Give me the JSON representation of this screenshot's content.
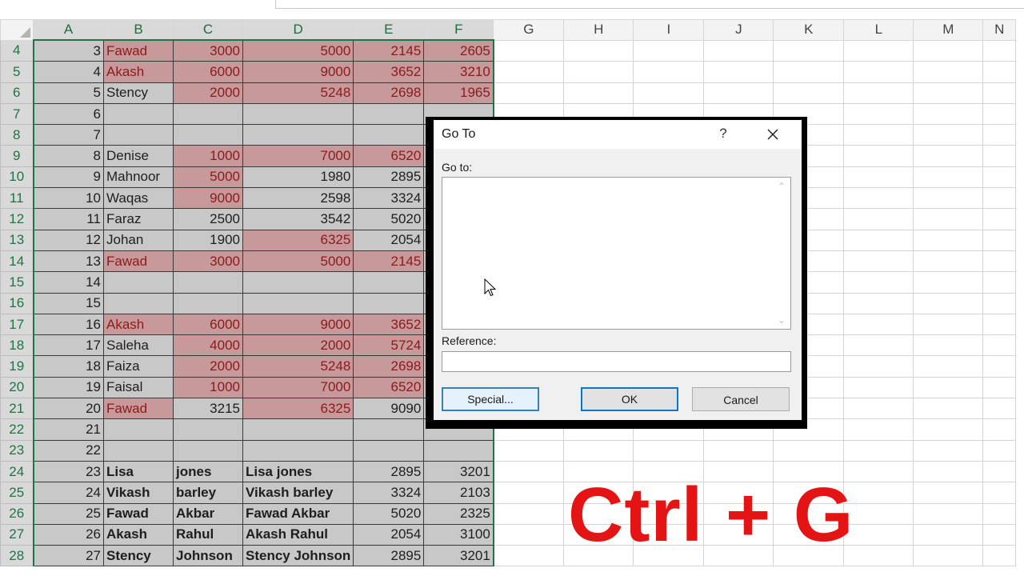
{
  "columns": [
    "A",
    "B",
    "C",
    "D",
    "E",
    "F",
    "G",
    "H",
    "I",
    "J",
    "K",
    "L",
    "M",
    "N"
  ],
  "rows": [
    {
      "n": "4",
      "cells": [
        {
          "v": "3",
          "k": "num"
        },
        {
          "v": "Fawad",
          "k": "txt",
          "h": 1
        },
        {
          "v": "3000",
          "k": "num",
          "h": 1
        },
        {
          "v": "5000",
          "k": "num",
          "h": 1
        },
        {
          "v": "2145",
          "k": "num",
          "h": 1
        },
        {
          "v": "2605",
          "k": "num",
          "h": 1
        }
      ]
    },
    {
      "n": "5",
      "cells": [
        {
          "v": "4",
          "k": "num"
        },
        {
          "v": "Akash",
          "k": "txt",
          "h": 1
        },
        {
          "v": "6000",
          "k": "num",
          "h": 1
        },
        {
          "v": "9000",
          "k": "num",
          "h": 1
        },
        {
          "v": "3652",
          "k": "num",
          "h": 1
        },
        {
          "v": "3210",
          "k": "num",
          "h": 1
        }
      ]
    },
    {
      "n": "6",
      "cells": [
        {
          "v": "5",
          "k": "num"
        },
        {
          "v": "Stency",
          "k": "txt"
        },
        {
          "v": "2000",
          "k": "num",
          "h": 1
        },
        {
          "v": "5248",
          "k": "num",
          "h": 1
        },
        {
          "v": "2698",
          "k": "num",
          "h": 1
        },
        {
          "v": "1965",
          "k": "num",
          "h": 1
        }
      ]
    },
    {
      "n": "7",
      "cells": [
        {
          "v": "6",
          "k": "num"
        },
        {
          "v": "",
          "k": "txt"
        },
        {
          "v": "",
          "k": "num"
        },
        {
          "v": "",
          "k": "num"
        },
        {
          "v": "",
          "k": "num"
        },
        {
          "v": "",
          "k": "num"
        }
      ]
    },
    {
      "n": "8",
      "cells": [
        {
          "v": "7",
          "k": "num"
        },
        {
          "v": "",
          "k": "txt"
        },
        {
          "v": "",
          "k": "num"
        },
        {
          "v": "",
          "k": "num"
        },
        {
          "v": "",
          "k": "num"
        },
        {
          "v": "",
          "k": "num"
        }
      ]
    },
    {
      "n": "9",
      "cells": [
        {
          "v": "8",
          "k": "num"
        },
        {
          "v": "Denise",
          "k": "txt"
        },
        {
          "v": "1000",
          "k": "num",
          "h": 1
        },
        {
          "v": "7000",
          "k": "num",
          "h": 1
        },
        {
          "v": "6520",
          "k": "num",
          "h": 1
        },
        {
          "v": "",
          "k": "num"
        }
      ]
    },
    {
      "n": "10",
      "cells": [
        {
          "v": "9",
          "k": "num"
        },
        {
          "v": "Mahnoor",
          "k": "txt"
        },
        {
          "v": "5000",
          "k": "num",
          "h": 1
        },
        {
          "v": "1980",
          "k": "num"
        },
        {
          "v": "2895",
          "k": "num"
        },
        {
          "v": "",
          "k": "num"
        }
      ]
    },
    {
      "n": "11",
      "cells": [
        {
          "v": "10",
          "k": "num"
        },
        {
          "v": "Waqas",
          "k": "txt"
        },
        {
          "v": "9000",
          "k": "num",
          "h": 1
        },
        {
          "v": "2598",
          "k": "num"
        },
        {
          "v": "3324",
          "k": "num"
        },
        {
          "v": "",
          "k": "num"
        }
      ]
    },
    {
      "n": "12",
      "cells": [
        {
          "v": "11",
          "k": "num"
        },
        {
          "v": "Faraz",
          "k": "txt"
        },
        {
          "v": "2500",
          "k": "num"
        },
        {
          "v": "3542",
          "k": "num"
        },
        {
          "v": "5020",
          "k": "num"
        },
        {
          "v": "",
          "k": "num"
        }
      ]
    },
    {
      "n": "13",
      "cells": [
        {
          "v": "12",
          "k": "num"
        },
        {
          "v": "Johan",
          "k": "txt"
        },
        {
          "v": "1900",
          "k": "num"
        },
        {
          "v": "6325",
          "k": "num",
          "h": 1
        },
        {
          "v": "2054",
          "k": "num"
        },
        {
          "v": "",
          "k": "num"
        }
      ]
    },
    {
      "n": "14",
      "cells": [
        {
          "v": "13",
          "k": "num"
        },
        {
          "v": "Fawad",
          "k": "txt",
          "h": 1
        },
        {
          "v": "3000",
          "k": "num",
          "h": 1
        },
        {
          "v": "5000",
          "k": "num",
          "h": 1
        },
        {
          "v": "2145",
          "k": "num",
          "h": 1
        },
        {
          "v": "",
          "k": "num"
        }
      ]
    },
    {
      "n": "15",
      "cells": [
        {
          "v": "14",
          "k": "num"
        },
        {
          "v": "",
          "k": "txt"
        },
        {
          "v": "",
          "k": "num"
        },
        {
          "v": "",
          "k": "num"
        },
        {
          "v": "",
          "k": "num"
        },
        {
          "v": "",
          "k": "num"
        }
      ]
    },
    {
      "n": "16",
      "cells": [
        {
          "v": "15",
          "k": "num"
        },
        {
          "v": "",
          "k": "txt"
        },
        {
          "v": "",
          "k": "num"
        },
        {
          "v": "",
          "k": "num"
        },
        {
          "v": "",
          "k": "num"
        },
        {
          "v": "",
          "k": "num"
        }
      ]
    },
    {
      "n": "17",
      "cells": [
        {
          "v": "16",
          "k": "num"
        },
        {
          "v": "Akash",
          "k": "txt",
          "h": 1
        },
        {
          "v": "6000",
          "k": "num",
          "h": 1
        },
        {
          "v": "9000",
          "k": "num",
          "h": 1
        },
        {
          "v": "3652",
          "k": "num",
          "h": 1
        },
        {
          "v": "",
          "k": "num"
        }
      ]
    },
    {
      "n": "18",
      "cells": [
        {
          "v": "17",
          "k": "num"
        },
        {
          "v": "Saleha",
          "k": "txt"
        },
        {
          "v": "4000",
          "k": "num",
          "h": 1
        },
        {
          "v": "2000",
          "k": "num",
          "h": 1
        },
        {
          "v": "5724",
          "k": "num",
          "h": 1
        },
        {
          "v": "",
          "k": "num"
        }
      ]
    },
    {
      "n": "19",
      "cells": [
        {
          "v": "18",
          "k": "num"
        },
        {
          "v": "Faiza",
          "k": "txt"
        },
        {
          "v": "2000",
          "k": "num",
          "h": 1
        },
        {
          "v": "5248",
          "k": "num",
          "h": 1
        },
        {
          "v": "2698",
          "k": "num",
          "h": 1
        },
        {
          "v": "",
          "k": "num"
        }
      ]
    },
    {
      "n": "20",
      "cells": [
        {
          "v": "19",
          "k": "num"
        },
        {
          "v": "Faisal",
          "k": "txt"
        },
        {
          "v": "1000",
          "k": "num",
          "h": 1
        },
        {
          "v": "7000",
          "k": "num",
          "h": 1
        },
        {
          "v": "6520",
          "k": "num",
          "h": 1
        },
        {
          "v": "",
          "k": "num"
        }
      ]
    },
    {
      "n": "21",
      "cells": [
        {
          "v": "20",
          "k": "num"
        },
        {
          "v": "Fawad",
          "k": "txt",
          "h": 1
        },
        {
          "v": "3215",
          "k": "num"
        },
        {
          "v": "6325",
          "k": "num",
          "h": 1
        },
        {
          "v": "9090",
          "k": "num"
        },
        {
          "v": "",
          "k": "num"
        }
      ]
    },
    {
      "n": "22",
      "cells": [
        {
          "v": "21",
          "k": "num"
        },
        {
          "v": "",
          "k": "txt"
        },
        {
          "v": "",
          "k": "num"
        },
        {
          "v": "",
          "k": "num"
        },
        {
          "v": "",
          "k": "num"
        },
        {
          "v": "",
          "k": "num"
        }
      ]
    },
    {
      "n": "23",
      "cells": [
        {
          "v": "22",
          "k": "num"
        },
        {
          "v": "",
          "k": "txt"
        },
        {
          "v": "",
          "k": "num"
        },
        {
          "v": "",
          "k": "num"
        },
        {
          "v": "",
          "k": "num"
        },
        {
          "v": "",
          "k": "num"
        }
      ]
    },
    {
      "n": "24",
      "cells": [
        {
          "v": "23",
          "k": "num"
        },
        {
          "v": "Lisa",
          "k": "txt",
          "b": 1
        },
        {
          "v": "jones",
          "k": "txt",
          "b": 1
        },
        {
          "v": "Lisa jones",
          "k": "txt",
          "b": 1
        },
        {
          "v": "2895",
          "k": "num"
        },
        {
          "v": "3201",
          "k": "num"
        }
      ]
    },
    {
      "n": "25",
      "cells": [
        {
          "v": "24",
          "k": "num"
        },
        {
          "v": "Vikash",
          "k": "txt",
          "b": 1
        },
        {
          "v": "barley",
          "k": "txt",
          "b": 1
        },
        {
          "v": "Vikash barley",
          "k": "txt",
          "b": 1
        },
        {
          "v": "3324",
          "k": "num"
        },
        {
          "v": "2103",
          "k": "num"
        }
      ]
    },
    {
      "n": "26",
      "cells": [
        {
          "v": "25",
          "k": "num"
        },
        {
          "v": "Fawad",
          "k": "txt",
          "b": 1
        },
        {
          "v": "Akbar",
          "k": "txt",
          "b": 1
        },
        {
          "v": "Fawad Akbar",
          "k": "txt",
          "b": 1
        },
        {
          "v": "5020",
          "k": "num"
        },
        {
          "v": "2325",
          "k": "num"
        }
      ]
    },
    {
      "n": "27",
      "cells": [
        {
          "v": "26",
          "k": "num"
        },
        {
          "v": "Akash",
          "k": "txt",
          "b": 1
        },
        {
          "v": "Rahul",
          "k": "txt",
          "b": 1
        },
        {
          "v": "Akash Rahul",
          "k": "txt",
          "b": 1
        },
        {
          "v": "2054",
          "k": "num"
        },
        {
          "v": "3100",
          "k": "num"
        }
      ]
    },
    {
      "n": "28",
      "cells": [
        {
          "v": "27",
          "k": "num"
        },
        {
          "v": "Stency",
          "k": "txt",
          "b": 1
        },
        {
          "v": "Johnson",
          "k": "txt",
          "b": 1
        },
        {
          "v": "Stency Johnson",
          "k": "txt",
          "b": 1
        },
        {
          "v": "2895",
          "k": "num"
        },
        {
          "v": "3201",
          "k": "num"
        }
      ]
    }
  ],
  "dialog": {
    "title": "Go To",
    "help": "?",
    "goto_label": "Go to:",
    "reference_label": "Reference:",
    "reference_value": "",
    "special_button": "Special...",
    "ok_button": "OK",
    "cancel_button": "Cancel"
  },
  "shortcut": "Ctrl + G",
  "colors": {
    "selection_green": "#217346",
    "highlight_fill": "#c8999b",
    "highlight_text": "#8b1a1a",
    "shortcut_red": "#e41414"
  }
}
